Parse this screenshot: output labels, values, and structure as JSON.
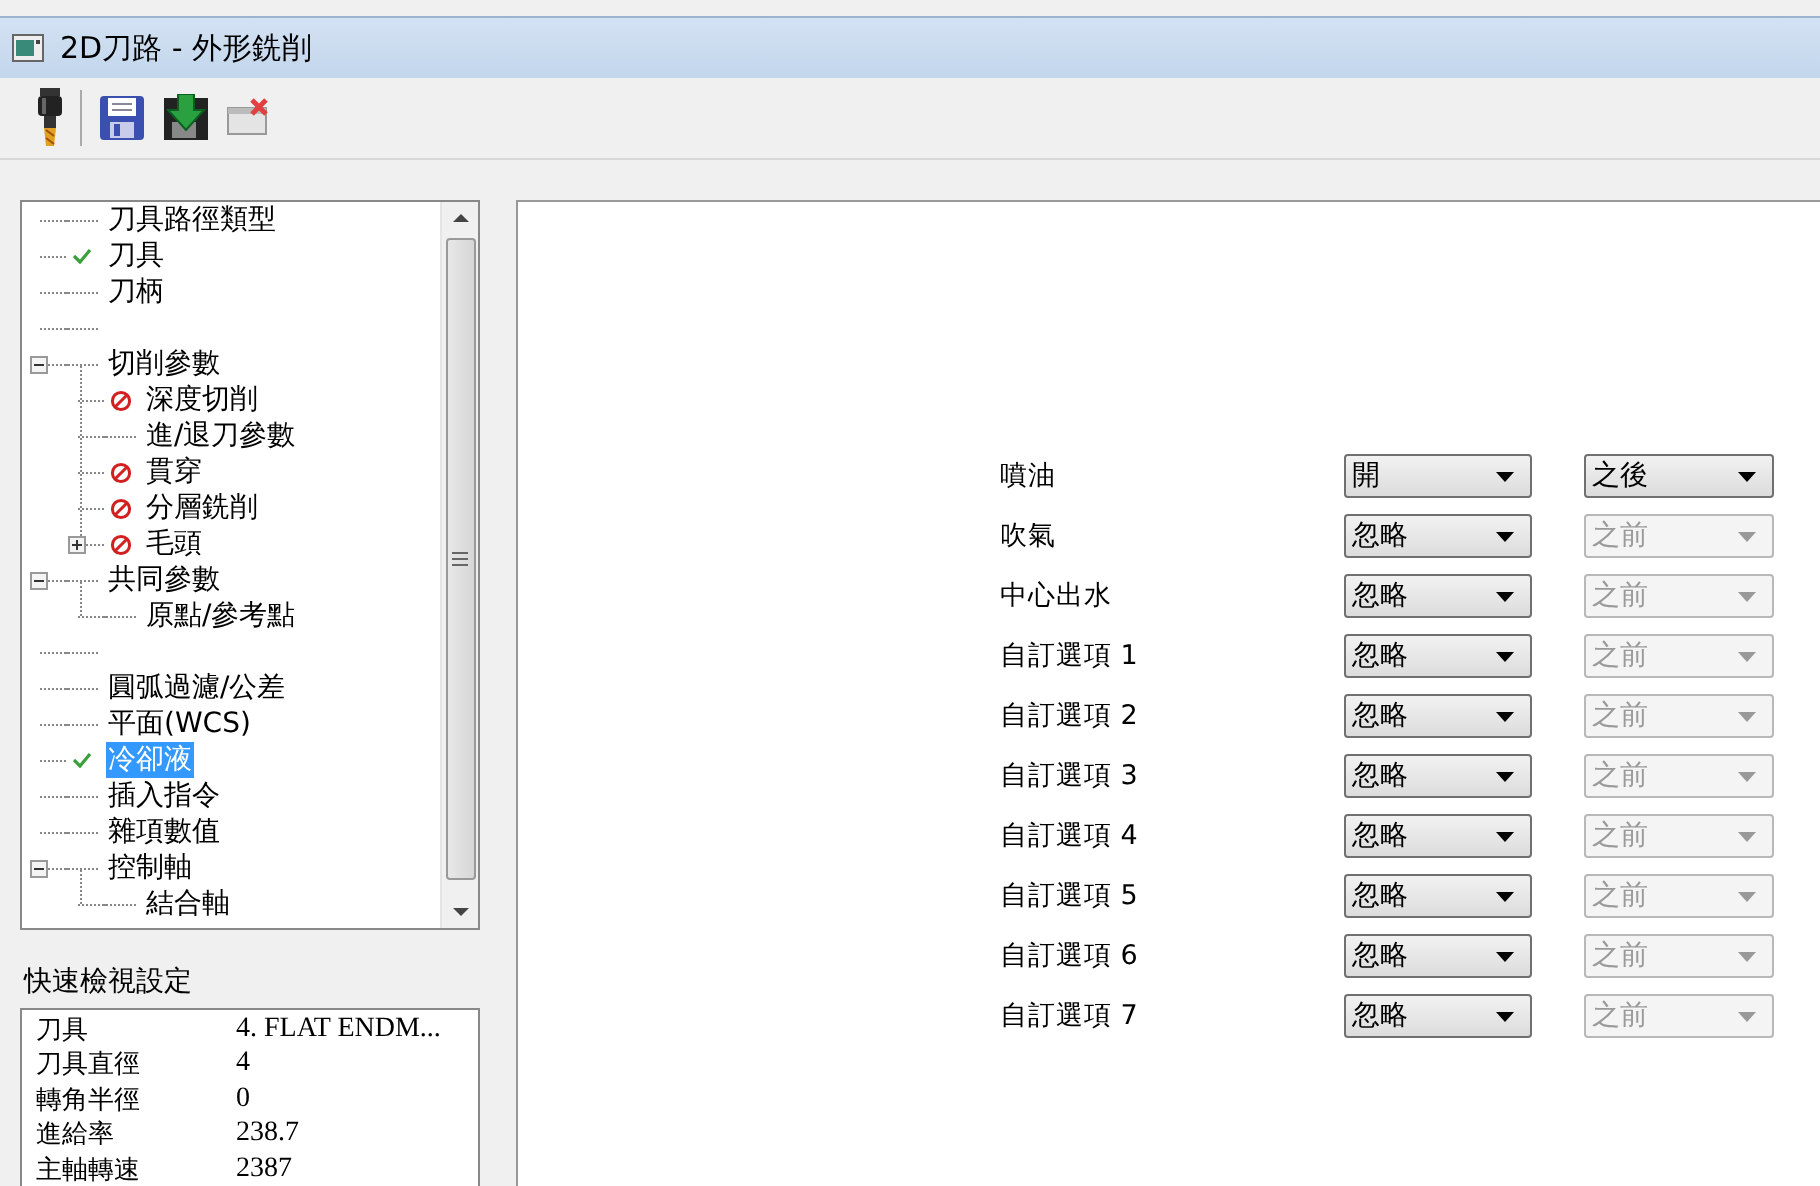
{
  "window": {
    "title": "2D刀路 - 外形銑削"
  },
  "toolbar": [
    {
      "kind": "tool"
    },
    {
      "kind": "save"
    },
    {
      "kind": "save-apply"
    },
    {
      "kind": "close"
    }
  ],
  "tree": [
    {
      "label": "刀具路徑類型",
      "kind": "plain",
      "selected": false
    },
    {
      "label": "刀具",
      "kind": "done",
      "selected": false
    },
    {
      "label": "刀柄",
      "kind": "plain",
      "selected": false
    },
    {
      "kind": "plain"
    },
    {
      "label": "切削參數",
      "kind": "plain",
      "selected": false,
      "expanded": true,
      "children": [
        {
          "label": "深度切削",
          "kind": "blocked",
          "selected": false
        },
        {
          "label": "進/退刀參數",
          "kind": "plain",
          "selected": false
        },
        {
          "label": "貫穿",
          "kind": "blocked",
          "selected": false
        },
        {
          "label": "分層銑削",
          "kind": "blocked",
          "selected": false
        },
        {
          "label": "毛頭",
          "kind": "blocked",
          "selected": false,
          "expanded": false
        }
      ]
    },
    {
      "label": "共同參數",
      "kind": "plain",
      "selected": false,
      "expanded": true,
      "children": [
        {
          "label": "原點/參考點",
          "kind": "plain",
          "selected": false
        }
      ]
    },
    {
      "kind": "plain"
    },
    {
      "label": "圓弧過濾/公差",
      "kind": "plain",
      "selected": false
    },
    {
      "label": "平面(WCS)",
      "kind": "plain",
      "selected": false
    },
    {
      "label": "冷卻液",
      "kind": "done",
      "selected": true
    },
    {
      "label": "插入指令",
      "kind": "plain",
      "selected": false
    },
    {
      "label": "雜項數值",
      "kind": "plain",
      "selected": false
    },
    {
      "label": "控制軸",
      "kind": "plain",
      "selected": false,
      "expanded": true,
      "children": [
        {
          "label": "結合軸",
          "kind": "plain",
          "selected": false
        }
      ]
    }
  ],
  "quick_view": {
    "title": "快速檢視設定",
    "rows": [
      {
        "name": "刀具",
        "value": "4. FLAT ENDM..."
      },
      {
        "name": "刀具直徑",
        "value": "4"
      },
      {
        "name": "轉角半徑",
        "value": "0"
      },
      {
        "name": "進給率",
        "value": "238.7"
      },
      {
        "name": "主軸轉速",
        "value": "2387"
      }
    ]
  },
  "coolant": [
    {
      "label": "噴油",
      "mode": "開",
      "timing": "之後",
      "timing_disabled": false
    },
    {
      "label": "吹氣",
      "mode": "忽略",
      "timing": "之前",
      "timing_disabled": true
    },
    {
      "label": "中心出水",
      "mode": "忽略",
      "timing": "之前",
      "timing_disabled": true
    },
    {
      "label": "自訂選項 1",
      "mode": "忽略",
      "timing": "之前",
      "timing_disabled": true
    },
    {
      "label": "自訂選項 2",
      "mode": "忽略",
      "timing": "之前",
      "timing_disabled": true
    },
    {
      "label": "自訂選項 3",
      "mode": "忽略",
      "timing": "之前",
      "timing_disabled": true
    },
    {
      "label": "自訂選項 4",
      "mode": "忽略",
      "timing": "之前",
      "timing_disabled": true
    },
    {
      "label": "自訂選項 5",
      "mode": "忽略",
      "timing": "之前",
      "timing_disabled": true
    },
    {
      "label": "自訂選項 6",
      "mode": "忽略",
      "timing": "之前",
      "timing_disabled": true
    },
    {
      "label": "自訂選項 7",
      "mode": "忽略",
      "timing": "之前",
      "timing_disabled": true
    }
  ]
}
